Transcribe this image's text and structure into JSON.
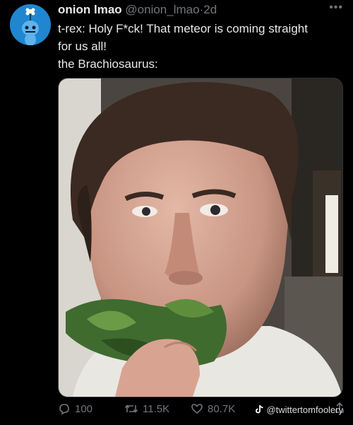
{
  "author": {
    "name": "onion lmao",
    "handle": "@onion_lmao",
    "separator": "·",
    "time": "2d"
  },
  "tweet": {
    "lines": [
      "t-rex: Holy F*ck! That meteor is coming straight",
      "for us all!",
      "the Brachiosaurus:"
    ]
  },
  "actions": {
    "replies": "100",
    "reposts": "11.5K",
    "likes": "80.7K"
  },
  "watermark": "@twittertomfoolery",
  "colors": {
    "background": "#000000",
    "text": "#e7e9ea",
    "muted": "#71767b",
    "avatar_bg": "#1f86cf"
  }
}
